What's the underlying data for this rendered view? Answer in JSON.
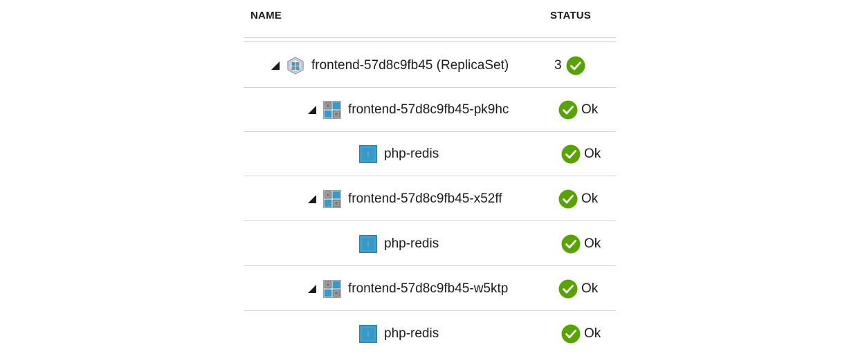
{
  "header": {
    "name": "NAME",
    "status": "STATUS"
  },
  "colors": {
    "ok_green": "#57a300",
    "container_blue": "#3999c6",
    "pod_gray": "#7a7a7a",
    "rule": "#cfcfcf"
  },
  "rows": [
    {
      "type": "replicaset",
      "icon": "replicaset-icon",
      "label": "frontend-57d8c9fb45 (ReplicaSet)",
      "status_count": "3",
      "status_text": "",
      "expandable": true
    },
    {
      "type": "pod",
      "icon": "pod-icon",
      "label": "frontend-57d8c9fb45-pk9hc",
      "status_text": "Ok",
      "expandable": true
    },
    {
      "type": "container",
      "icon": "container-icon",
      "label": "php-redis",
      "status_text": "Ok",
      "expandable": false
    },
    {
      "type": "pod",
      "icon": "pod-icon",
      "label": "frontend-57d8c9fb45-x52ff",
      "status_text": "Ok",
      "expandable": true
    },
    {
      "type": "container",
      "icon": "container-icon",
      "label": "php-redis",
      "status_text": "Ok",
      "expandable": false
    },
    {
      "type": "pod",
      "icon": "pod-icon",
      "label": "frontend-57d8c9fb45-w5ktp",
      "status_text": "Ok",
      "expandable": true
    },
    {
      "type": "container",
      "icon": "container-icon",
      "label": "php-redis",
      "status_text": "Ok",
      "expandable": false
    }
  ]
}
